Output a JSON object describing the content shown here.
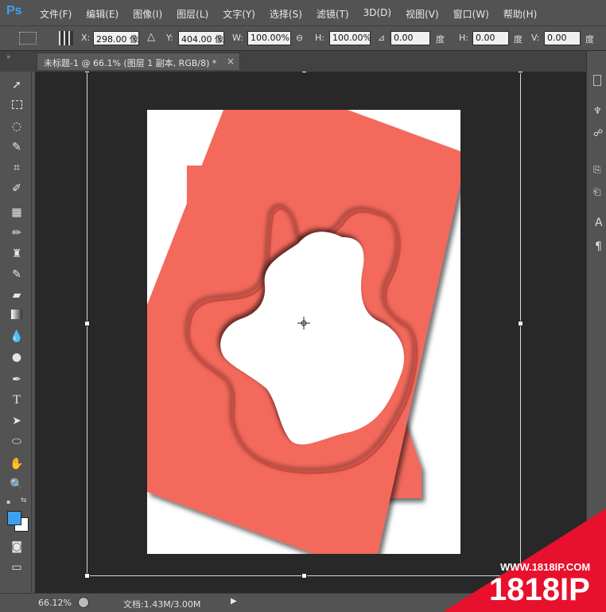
{
  "app": {
    "logo": "Ps"
  },
  "menu": [
    "文件(F)",
    "编辑(E)",
    "图像(I)",
    "图层(L)",
    "文字(Y)",
    "选择(S)",
    "滤镜(T)",
    "3D(D)",
    "视图(V)",
    "窗口(W)",
    "帮助(H)"
  ],
  "options": {
    "x_label": "X:",
    "x_value": "298.00 像",
    "y_label": "Y:",
    "y_value": "404.00 像",
    "w_label": "W:",
    "w_value": "100.00%",
    "h_label": "H:",
    "h_value": "100.00%",
    "angle_value": "0.00",
    "angle_unit": "度",
    "hskew_label": "H:",
    "hskew_value": "0.00",
    "hskew_unit": "度",
    "vskew_label": "V:",
    "vskew_value": "0.00",
    "vskew_unit": "度"
  },
  "tab": {
    "title": "未标题-1 @ 66.1% (图层 1 副本, RGB/8) *",
    "close": "×"
  },
  "status": {
    "zoom": "66.12%",
    "doc_info": "文档:1.43M/3.00M"
  },
  "colors": {
    "foreground": "#3ea1f0",
    "background": "#ffffff",
    "layer": "#f2695d",
    "watermark": "#e8112d"
  },
  "watermark": {
    "url": "WWW.1818IP.COM",
    "brand": "1818IP"
  }
}
